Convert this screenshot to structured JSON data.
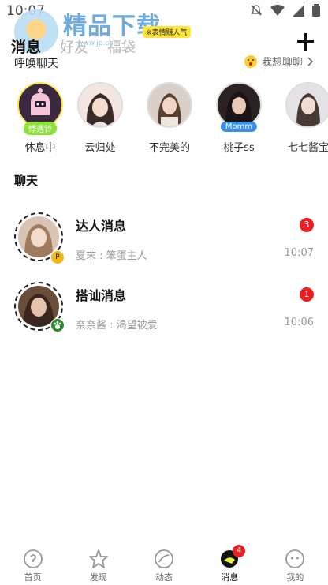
{
  "status_bar": {
    "time": "10:07"
  },
  "watermark": {
    "text": "精品下载",
    "sub": "www.jp.com"
  },
  "top_tabs": [
    {
      "label": "消息",
      "active": true
    },
    {
      "label": "好友",
      "active": false
    },
    {
      "label": "福袋",
      "active": false
    }
  ],
  "hot_tag": "※表情赚人气",
  "call_bar": {
    "title": "呼唤聊天",
    "want_chat": "我想聊聊"
  },
  "stories": [
    {
      "name": "休息中",
      "badge": "悸遇铃"
    },
    {
      "name": "云归处",
      "badge": ""
    },
    {
      "name": "不完美的",
      "badge": ""
    },
    {
      "name": "桃子ss",
      "badge": "Momm"
    },
    {
      "name": "七七酱宝",
      "badge": ""
    }
  ],
  "section": {
    "title": "聊天"
  },
  "chats": [
    {
      "name": "达人消息",
      "preview": "夏末 : 笨蛋主人",
      "time": "10:07",
      "unread": "3"
    },
    {
      "name": "搭讪消息",
      "preview": "奈奈酱 : 渴望被爱",
      "time": "10:06",
      "unread": "1"
    }
  ],
  "bottom_nav": [
    {
      "label": "首页",
      "icon": "home-icon"
    },
    {
      "label": "发现",
      "icon": "discover-icon"
    },
    {
      "label": "动态",
      "icon": "moments-icon"
    },
    {
      "label": "消息",
      "icon": "message-icon",
      "count": "4",
      "active": true
    },
    {
      "label": "我的",
      "icon": "profile-icon"
    }
  ],
  "colors": {
    "accent_yellow": "#e6f53a",
    "badge_red": "#ee1d24",
    "badge_blue": "#3b8fe6",
    "badge_green": "#8ee03a"
  }
}
